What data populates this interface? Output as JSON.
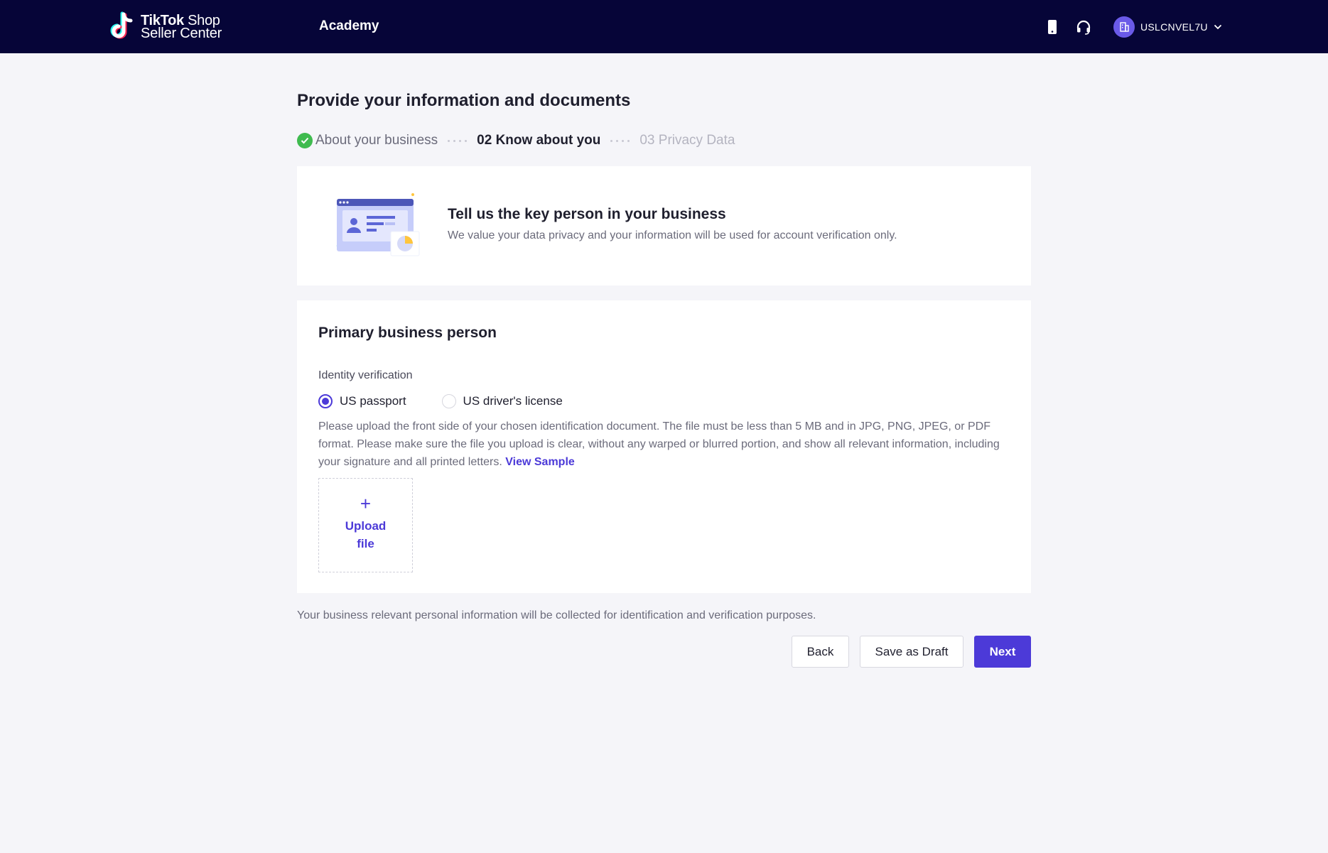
{
  "header": {
    "logo_line1_brand": "TikTok",
    "logo_line1_product": "Shop",
    "logo_line2": "Seller Center",
    "nav_academy": "Academy",
    "account_name": "USLCNVEL7U"
  },
  "page": {
    "title": "Provide your information and documents"
  },
  "steps": [
    {
      "label": "About your business",
      "state": "done"
    },
    {
      "label": "02 Know about you",
      "state": "active"
    },
    {
      "label": "03 Privacy Data",
      "state": "pending"
    }
  ],
  "intro": {
    "heading": "Tell us the key person in your business",
    "subtext": "We value your data privacy and your information will be used for account verification only."
  },
  "form": {
    "section_title": "Primary business person",
    "field_label": "Identity verification",
    "options": [
      {
        "label": "US passport",
        "selected": true
      },
      {
        "label": "US driver's license",
        "selected": false
      }
    ],
    "instructions": "Please upload the front side of your chosen identification document. The file must be less than 5 MB and in JPG, PNG, JPEG, or PDF format. Please make sure the file you upload is clear, without any warped or blurred portion, and show all relevant information, including your signature and all printed letters.",
    "view_sample": "View Sample",
    "upload_plus": "+",
    "upload_label": "Upload file"
  },
  "footer": {
    "note": "Your business relevant personal information will be collected for identification and verification purposes.",
    "back": "Back",
    "save_draft": "Save as Draft",
    "next": "Next"
  },
  "icons": {
    "mobile": "mobile-phone-icon",
    "support": "headset-icon",
    "avatar": "building-icon",
    "dropdown": "chevron-down-icon"
  },
  "colors": {
    "topbar": "#060538",
    "accent": "#4c3ad8",
    "success": "#3fbb4f",
    "page_bg": "#f5f5f9"
  }
}
